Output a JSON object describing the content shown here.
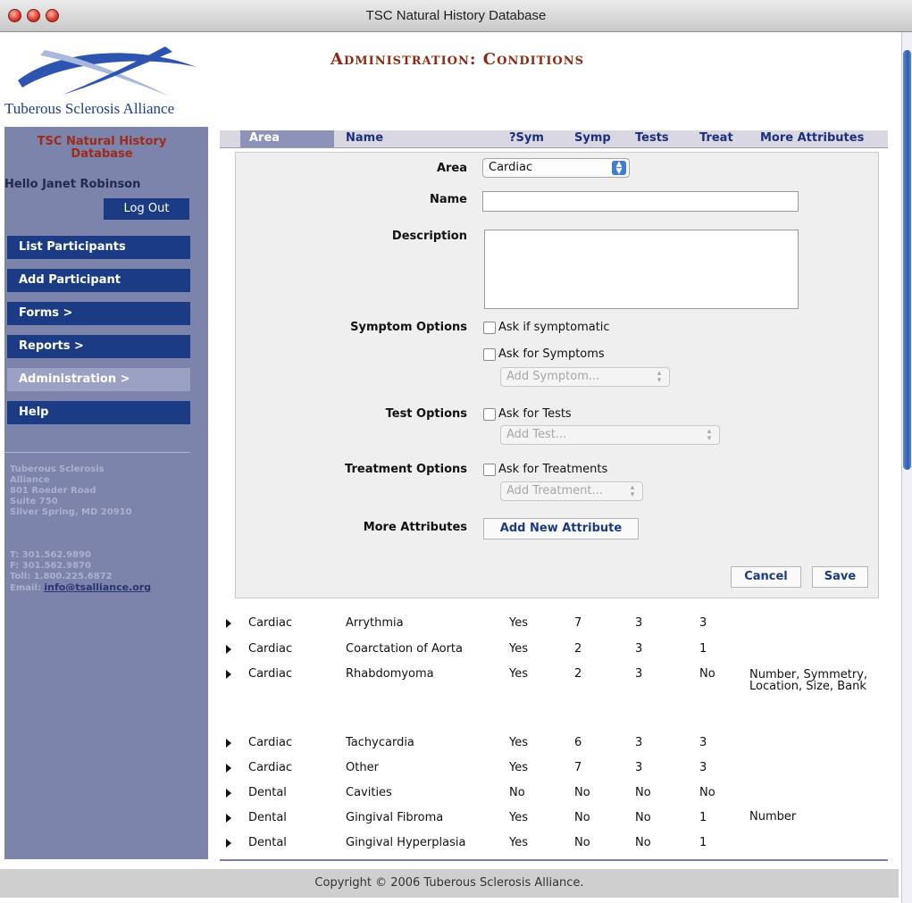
{
  "window": {
    "title": "TSC Natural History Database"
  },
  "brand": {
    "name": "Tuberous Sclerosis Alliance"
  },
  "page": {
    "title": "Administration: Conditions"
  },
  "sidebar": {
    "app_name": "TSC Natural History Database",
    "greeting": "Hello Janet Robinson",
    "logout_label": "Log Out",
    "nav": [
      {
        "label": "List Participants"
      },
      {
        "label": "Add Participant"
      },
      {
        "label": "Forms >"
      },
      {
        "label": "Reports >"
      },
      {
        "label": "Administration >",
        "active": true
      },
      {
        "label": "Help"
      }
    ],
    "address_lines": [
      "Tuberous Sclerosis",
      "Alliance",
      "801 Roeder Road",
      "Suite 750",
      "Silver Spring, MD 20910"
    ],
    "phone": "T: 301.562.9890",
    "fax": "F: 301.562.9870",
    "toll": "Toll: 1.800.225.6872",
    "email_label": "Email:",
    "email": "info@tsalliance.org"
  },
  "grid": {
    "columns": [
      "Area",
      "Name",
      "?Sym",
      "Symp",
      "Tests",
      "Treat",
      "More Attributes"
    ],
    "rows": [
      {
        "area": "Cardiac",
        "name": "Arrythmia",
        "sym": "Yes",
        "symp": "7",
        "tests": "3",
        "treat": "3",
        "more": ""
      },
      {
        "area": "Cardiac",
        "name": "Coarctation of Aorta",
        "sym": "Yes",
        "symp": "2",
        "tests": "3",
        "treat": "1",
        "more": ""
      },
      {
        "area": "Cardiac",
        "name": "Rhabdomyoma",
        "sym": "Yes",
        "symp": "2",
        "tests": "3",
        "treat": "No",
        "more": "Number, Symmetry, Location, Size, Bank"
      },
      {
        "area": "Cardiac",
        "name": "Tachycardia",
        "sym": "Yes",
        "symp": "6",
        "tests": "3",
        "treat": "3",
        "more": ""
      },
      {
        "area": "Cardiac",
        "name": "Other",
        "sym": "Yes",
        "symp": "7",
        "tests": "3",
        "treat": "3",
        "more": ""
      },
      {
        "area": "Dental",
        "name": "Cavities",
        "sym": "No",
        "symp": "No",
        "tests": "No",
        "treat": "No",
        "more": ""
      },
      {
        "area": "Dental",
        "name": "Gingival Fibroma",
        "sym": "Yes",
        "symp": "No",
        "tests": "No",
        "treat": "1",
        "more": "Number"
      },
      {
        "area": "Dental",
        "name": "Gingival Hyperplasia",
        "sym": "Yes",
        "symp": "No",
        "tests": "No",
        "treat": "1",
        "more": ""
      }
    ]
  },
  "editor": {
    "area_label": "Area",
    "area_value": "Cardiac",
    "name_label": "Name",
    "name_value": "",
    "description_label": "Description",
    "description_value": "",
    "symptom_options_label": "Symptom Options",
    "ask_if_symptomatic": "Ask if symptomatic",
    "ask_for_symptoms": "Ask for Symptoms",
    "add_symptom": "Add Symptom...",
    "test_options_label": "Test Options",
    "ask_for_tests": "Ask for Tests",
    "add_test": "Add Test...",
    "treatment_options_label": "Treatment Options",
    "ask_for_treatments": "Ask for Treatments",
    "add_treatment": "Add Treatment...",
    "more_attributes_label": "More Attributes",
    "add_attribute_button": "Add New Attribute",
    "cancel_button": "Cancel",
    "save_button": "Save"
  },
  "footer": {
    "copyright": "Copyright © 2006 Tuberous Sclerosis Alliance."
  },
  "colors": {
    "nav_button": "#1b3c84",
    "sidebar": "#7d84ab",
    "title_red": "#8b2a12",
    "link_blue": "#1c3b83"
  }
}
